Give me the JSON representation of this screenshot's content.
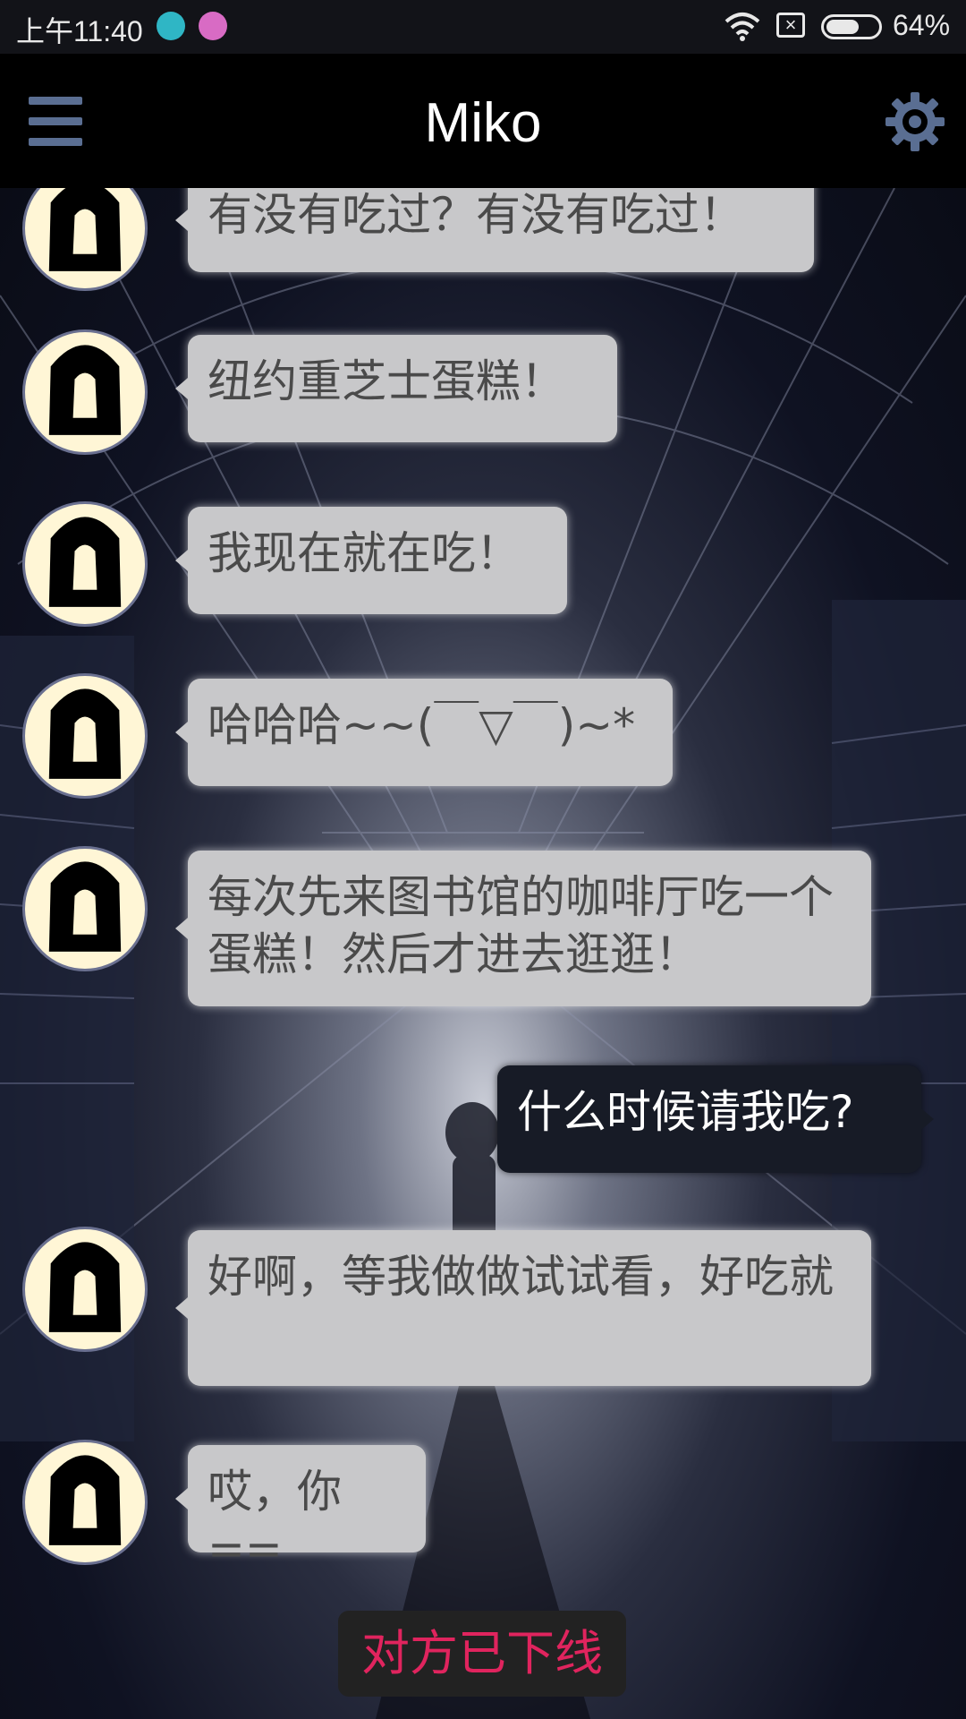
{
  "status_bar": {
    "time": "上午11:40",
    "battery_percent": "64%",
    "battery_level": 0.64
  },
  "header": {
    "title": "Miko"
  },
  "messages": [
    {
      "sender": "other",
      "text": "有没有吃过？有没有吃过！"
    },
    {
      "sender": "other",
      "text": "纽约重芝士蛋糕！"
    },
    {
      "sender": "other",
      "text": "我现在就在吃！"
    },
    {
      "sender": "other",
      "text": "哈哈哈~~(￣▽￣)~*"
    },
    {
      "sender": "other",
      "text": "每次先来图书馆的咖啡厅吃一个蛋糕！然后才进去逛逛！"
    },
    {
      "sender": "me",
      "text": "什么时候请我吃?"
    },
    {
      "sender": "other",
      "text": "好啊，等我做做试试看，好吃就"
    },
    {
      "sender": "other",
      "text": "哎，你=="
    }
  ],
  "offline_notice": "对方已下线",
  "colors": {
    "accent_offline": "#e0245e",
    "bubble_other": "#c8c8ca",
    "bubble_me": "#171b26",
    "icon_accent": "#5a6e92"
  }
}
